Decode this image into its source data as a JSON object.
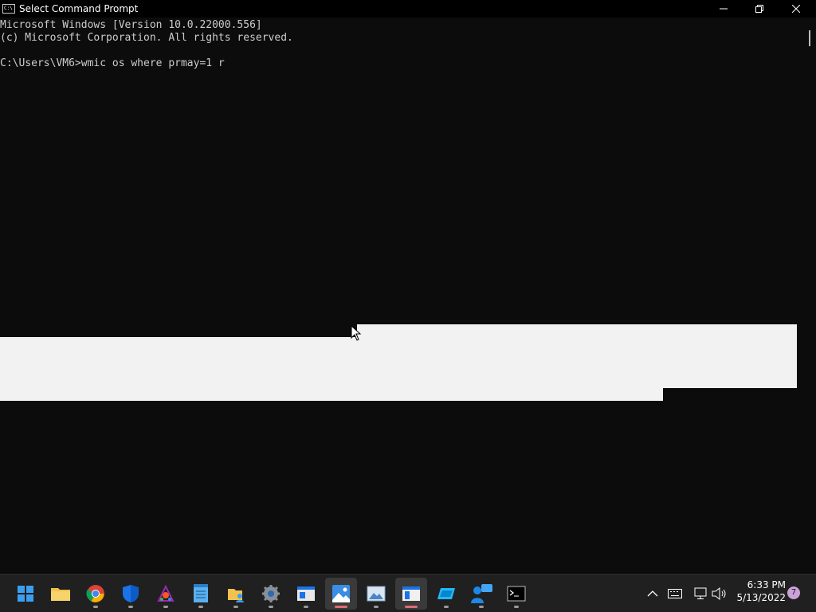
{
  "window": {
    "title": "Select Command Prompt",
    "app_icon_text": "C:\\",
    "controls": [
      "minimize-icon",
      "restore-icon",
      "close-icon"
    ]
  },
  "console": {
    "lines": [
      "Microsoft Windows [Version 10.0.22000.556]",
      "(c) Microsoft Corporation. All rights reserved.",
      "",
      "C:\\Users\\VM6>wmic os where prmay=1 r"
    ]
  },
  "taskbar": {
    "apps": [
      {
        "name": "start-button",
        "icon": "windows-logo-icon"
      },
      {
        "name": "file-explorer",
        "icon": "folder-icon"
      },
      {
        "name": "chrome",
        "icon": "chrome-icon"
      },
      {
        "name": "windows-security",
        "icon": "shield-icon"
      },
      {
        "name": "paint-3d",
        "icon": "paint-icon"
      },
      {
        "name": "notepad",
        "icon": "notepad-icon"
      },
      {
        "name": "files-app",
        "icon": "folder-person-icon"
      },
      {
        "name": "settings",
        "icon": "gear-icon"
      },
      {
        "name": "window-app",
        "icon": "window-icon"
      },
      {
        "name": "photos",
        "icon": "photos-icon"
      },
      {
        "name": "image-viewer",
        "icon": "image-icon"
      },
      {
        "name": "notes-app",
        "icon": "notes-icon"
      },
      {
        "name": "tablet-app",
        "icon": "tablet-icon"
      },
      {
        "name": "people-app",
        "icon": "people-icon"
      },
      {
        "name": "command-prompt",
        "icon": "terminal-icon"
      }
    ],
    "tray": {
      "icons": [
        "chevron-up-icon",
        "keyboard-icon",
        "network-icon",
        "volume-icon"
      ],
      "time": "6:33 PM",
      "date": "5/13/2022",
      "notification_count": "7"
    }
  }
}
